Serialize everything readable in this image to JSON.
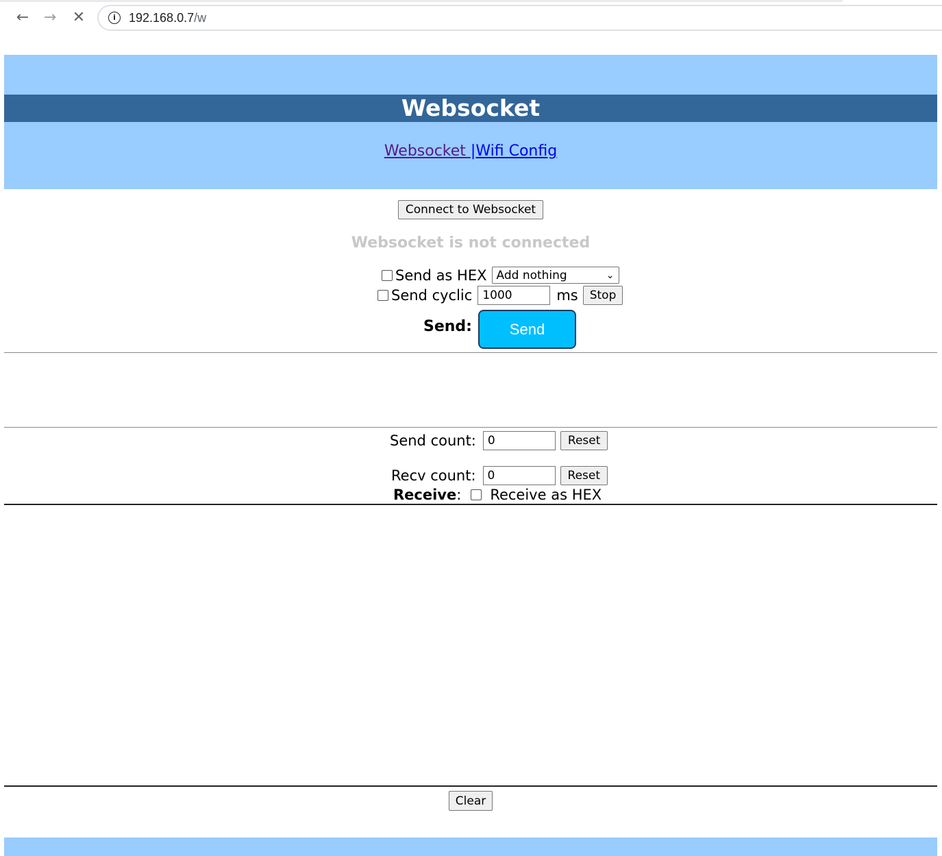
{
  "browser": {
    "url_host": "192.168.0.7",
    "url_path": "/w"
  },
  "header": {
    "title": "Websocket",
    "nav": [
      {
        "label": "Websocket "
      },
      {
        "label": "|"
      },
      {
        "label": "Wifi Config"
      }
    ]
  },
  "controls": {
    "connect_label": "Connect to Websocket",
    "status_text": "Websocket is not connected",
    "send_as_hex_label": "Send as HEX",
    "append_select_value": "Add nothing",
    "send_cyclic_label": "Send cyclic",
    "cyclic_interval": "1000",
    "interval_unit": "ms",
    "stop_label": "Stop",
    "send_label": "Send:",
    "send_button": "Send"
  },
  "counters": {
    "send_count_label": "Send count:",
    "send_count_value": "0",
    "recv_count_label": "Recv count:",
    "recv_count_value": "0",
    "reset_label": "Reset"
  },
  "receive": {
    "label": "Receive",
    "colon": ":",
    "as_hex_label": "Receive as HEX"
  },
  "clear_label": "Clear"
}
